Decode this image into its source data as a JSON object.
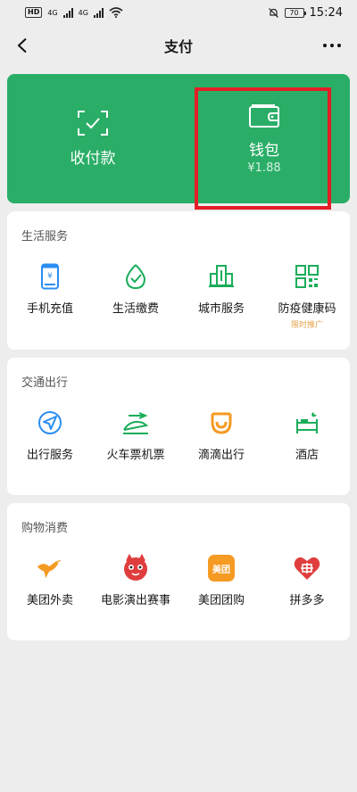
{
  "status_bar": {
    "hd": "HD",
    "net1": "4G",
    "net2": "4G",
    "battery": "70",
    "time": "15:24"
  },
  "nav": {
    "title": "支付"
  },
  "wallet_card": {
    "receive_pay_label": "收付款",
    "wallet_label": "钱包",
    "wallet_balance": "¥1.88"
  },
  "sections": [
    {
      "title": "生活服务",
      "items": [
        {
          "label": "手机充值",
          "icon": "mobile-recharge-icon"
        },
        {
          "label": "生活缴费",
          "icon": "utility-payment-icon"
        },
        {
          "label": "城市服务",
          "icon": "city-service-icon"
        },
        {
          "label": "防疫健康码",
          "icon": "health-code-icon",
          "tag": "限时推广"
        }
      ]
    },
    {
      "title": "交通出行",
      "items": [
        {
          "label": "出行服务",
          "icon": "travel-navigation-icon"
        },
        {
          "label": "火车票机票",
          "icon": "train-plane-icon"
        },
        {
          "label": "滴滴出行",
          "icon": "didi-icon"
        },
        {
          "label": "酒店",
          "icon": "hotel-bed-icon"
        }
      ]
    },
    {
      "title": "购物消费",
      "items": [
        {
          "label": "美团外卖",
          "icon": "meituan-kangaroo-icon"
        },
        {
          "label": "电影演出赛事",
          "icon": "movie-cat-icon"
        },
        {
          "label": "美团团购",
          "icon": "meituan-group-icon",
          "icon_text": "美团"
        },
        {
          "label": "拼多多",
          "icon": "pinduoduo-icon"
        }
      ]
    }
  ],
  "colors": {
    "brand_green": "#2aae67",
    "highlight_red": "#e41e26",
    "icon_blue": "#2b8ef2",
    "icon_green": "#1aad5a",
    "icon_orange": "#f59a23",
    "icon_red": "#e03e3e",
    "tag_orange": "#e5a24a"
  }
}
